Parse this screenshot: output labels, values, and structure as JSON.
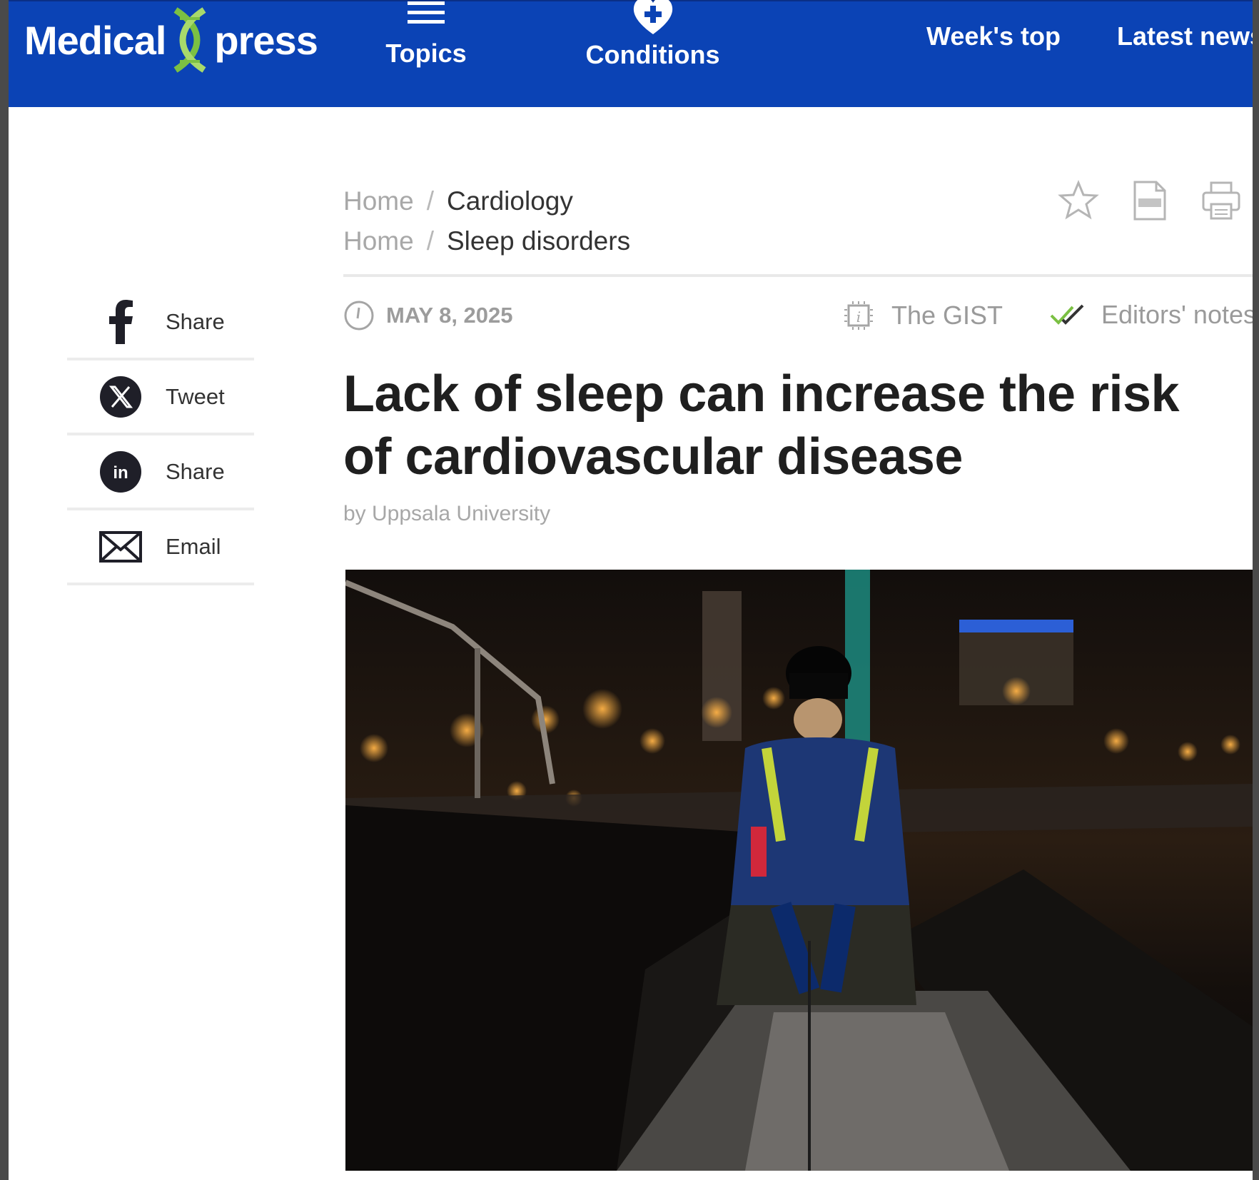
{
  "header": {
    "logo_left": "Medical",
    "logo_right": "press",
    "nav": {
      "topics": "Topics",
      "conditions": "Conditions",
      "weeks_top": "Week's top",
      "latest_news": "Latest news"
    }
  },
  "breadcrumbs": [
    {
      "home": "Home",
      "category": "Cardiology"
    },
    {
      "home": "Home",
      "category": "Sleep disorders"
    }
  ],
  "share": [
    {
      "icon": "facebook-icon",
      "label": "Share"
    },
    {
      "icon": "x-icon",
      "label": "Tweet"
    },
    {
      "icon": "linkedin-icon",
      "label": "Share"
    },
    {
      "icon": "email-icon",
      "label": "Email"
    }
  ],
  "article": {
    "date": "MAY 8, 2025",
    "gist_label": "The GIST",
    "editors_notes_label": "Editors' notes",
    "title": "Lack of sleep can increase the risk of cardiovascular disease",
    "byline": "by Uppsala University"
  },
  "colors": {
    "header_bg": "#0b43b5",
    "logo_accent": "#7bc043",
    "text_dark": "#1f1f1f",
    "muted": "#9a9a9a"
  }
}
